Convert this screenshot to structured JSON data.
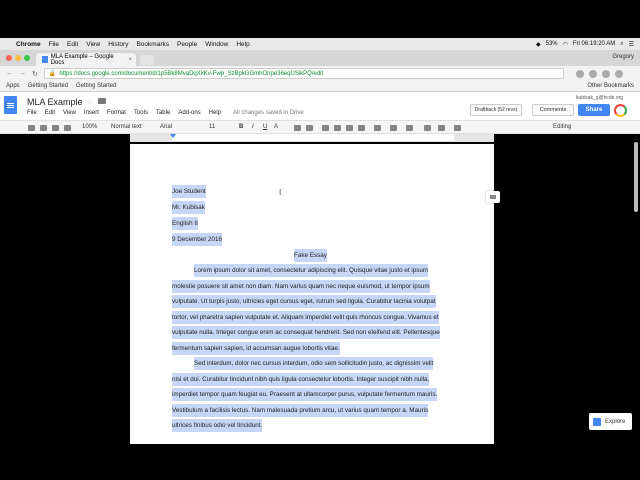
{
  "menubar": {
    "app": "Chrome",
    "items": [
      "File",
      "Edit",
      "View",
      "History",
      "Bookmarks",
      "People",
      "Window",
      "Help"
    ],
    "battery": "53%",
    "clock": "Fri 06:19:20 AM"
  },
  "tab": {
    "title": "MLA Example – Google Docs",
    "close": "×"
  },
  "profile": "Gregory",
  "address": {
    "url": "https://docs.google.com/document/d/1p5Bk8MvaDqXkKv-Fwp_SzBpkGGmhOnpe36eqUSikPQ/edit"
  },
  "bookmarks": {
    "apps": "Apps",
    "item1": "Getting Started",
    "item2": "Getting Started",
    "other": "Other Bookmarks"
  },
  "doc": {
    "title": "MLA Example",
    "menu": [
      "File",
      "Edit",
      "View",
      "Insert",
      "Format",
      "Tools",
      "Table",
      "Add-ons",
      "Help"
    ],
    "saved": "All changes saved in Drive",
    "draftback": "Draftback (52 revs)",
    "comments": "Comments",
    "share": "Share",
    "account": "kubisak_g@hcde.org"
  },
  "toolbar": {
    "zoom": "100%",
    "style": "Normal text",
    "font": "Arial",
    "size": "11",
    "mode": "Editing"
  },
  "content": {
    "l1": "Joe Student",
    "l2": "Mr. Kubisak",
    "l3": "English II",
    "l4": "9 December 2016",
    "l5": "Fake Essay",
    "l6": "Lorem ipsum dolor sit amet, consectetur adipiscing elit. Quisque vitae justo et ipsum",
    "l7": "molestie posuere sit amet non diam. Nam varius quam nec neque euismod, ut tempor ipsum",
    "l8": "vulputate. Ut turpis justo, ultricies eget cursus eget, rutrum sed ligula. Curabitur lacinia volutpat",
    "l9": "tortor, vel pharetra sapien vulputate et. Aliquam imperdiet velit quis rhoncus congue. Vivamus et",
    "l10": "vulputate nulla. Integer congue enim ac consequat hendrerit. Sed non eleifend elit. Pellentesque",
    "l11": "fermentum sapien sapien, id accumsan augue lobortis vitae.",
    "l12": "Sed interdum, dolor nec cursus interdum, odio sem sollicitudin justo, ac dignissim velit",
    "l13": "nisi et dui. Curabitur tincidunt nibh quis ligula consectetur lobortis. Integer suscipit nibh nulla,",
    "l14": "imperdiet tempor quam feugiat eu. Praesent at ullamcorper purus, vulputate fermentum mauris.",
    "l15": "Vestibulum a facilisis lectus. Nam malesuada pretium arcu, ut varius quam tempor a. Mauris",
    "l16": "ultrices finibus odio vel tincidunt."
  },
  "explore": "Explore",
  "colors": {
    "accent": "#4285f4",
    "selection": "#c6d6f6"
  }
}
